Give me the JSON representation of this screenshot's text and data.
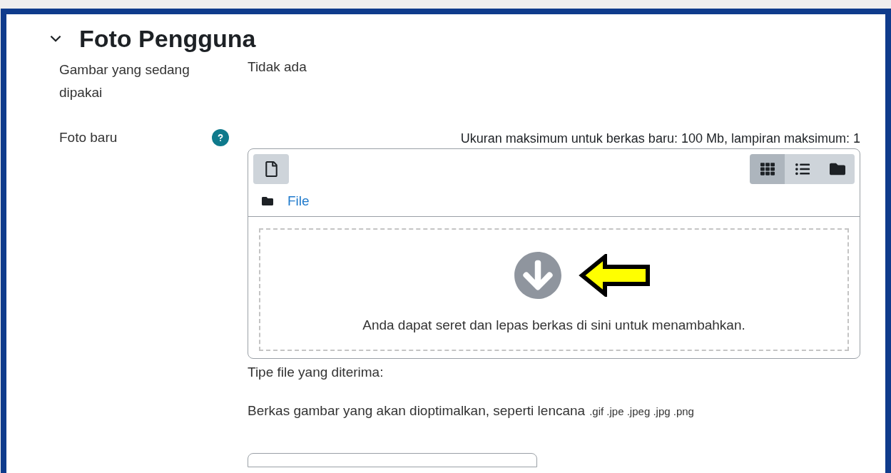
{
  "section": {
    "title": "Foto Pengguna",
    "expanded": true
  },
  "current_picture": {
    "label": "Gambar yang sedang dipakai",
    "value": "Tidak ada"
  },
  "new_photo": {
    "label": "Foto baru",
    "limits": "Ukuran maksimum untuk berkas baru: 100 Mb, lampiran maksimum: 1",
    "views": [
      {
        "kind": "grid",
        "selected": true
      },
      {
        "kind": "list",
        "selected": false
      },
      {
        "kind": "folder",
        "selected": false
      }
    ],
    "path": "File",
    "drop_text": "Anda dapat seret dan lepas berkas di sini untuk menambahkan.",
    "accepted_label": "Tipe file yang diterima:",
    "accepted_desc": "Berkas gambar yang akan dioptimalkan, seperti lencana",
    "extensions": ".gif .jpe .jpeg .jpg .png"
  }
}
